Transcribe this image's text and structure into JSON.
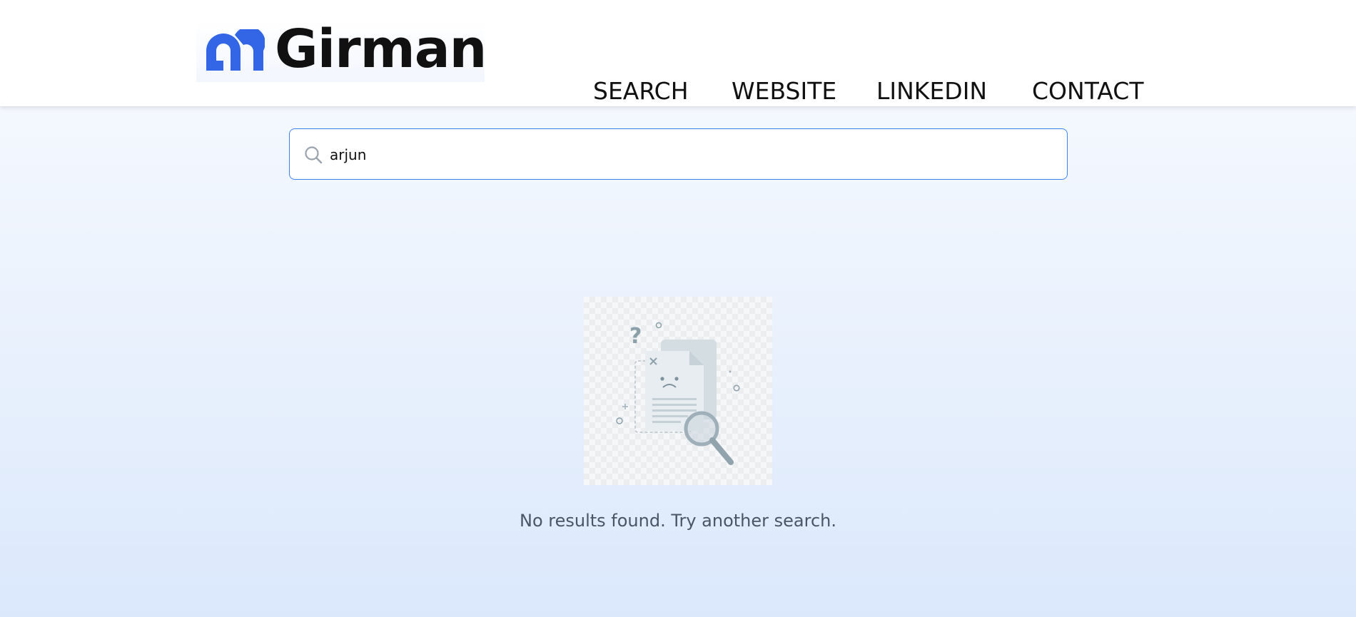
{
  "header": {
    "brand": "Girman",
    "nav": [
      {
        "label": "SEARCH"
      },
      {
        "label": "WEBSITE"
      },
      {
        "label": "LINKEDIN"
      },
      {
        "label": "CONTACT"
      }
    ]
  },
  "search": {
    "value": "arjun",
    "icon": "search-icon"
  },
  "empty_state": {
    "message": "No results found. Try another search.",
    "illustration": "no-results-document-magnifier-icon"
  },
  "colors": {
    "brand_blue": "#3366e6",
    "input_border": "#3b82f6",
    "text_dark": "#111111",
    "text_muted": "#4b5563"
  }
}
